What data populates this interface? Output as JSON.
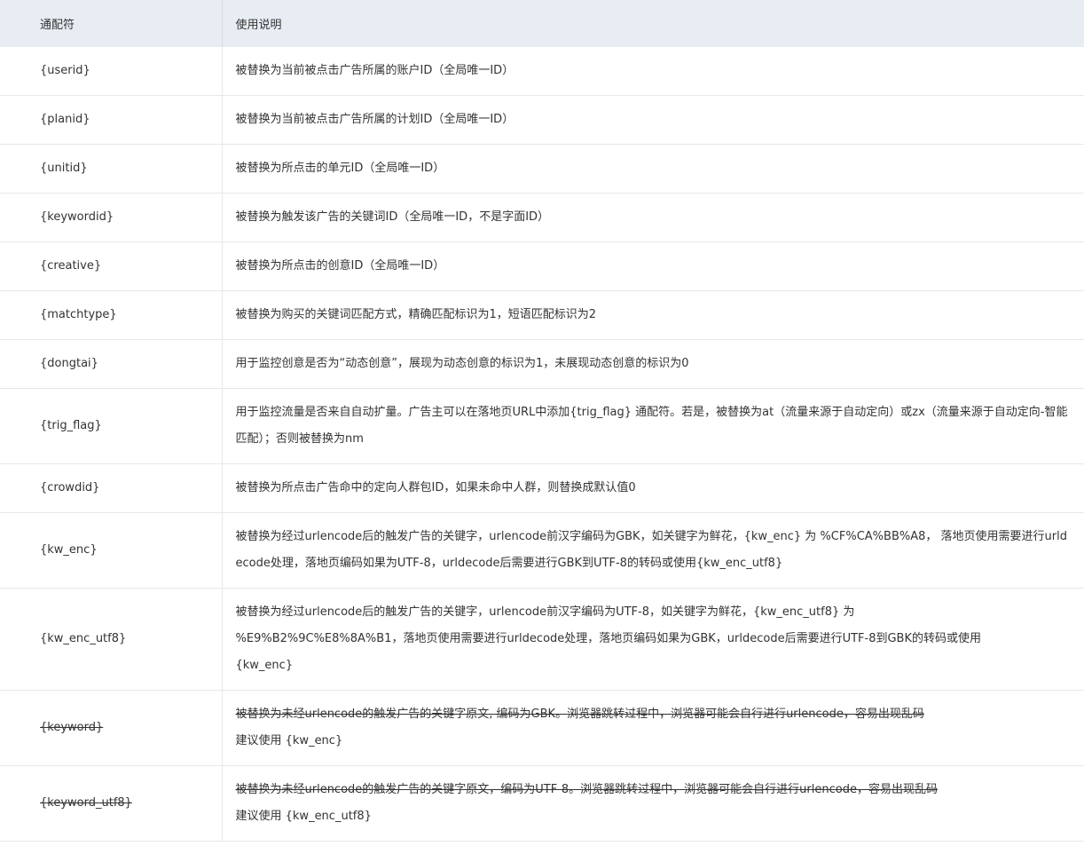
{
  "header": {
    "col_placeholder": "通配符",
    "col_description": "使用说明"
  },
  "rows": [
    {
      "placeholder": "{userid}",
      "description": "被替换为当前被点击广告所属的账户ID（全局唯一ID）"
    },
    {
      "placeholder": "{planid}",
      "description": "被替换为当前被点击广告所属的计划ID（全局唯一ID）"
    },
    {
      "placeholder": "{unitid}",
      "description": "被替换为所点击的单元ID（全局唯一ID）"
    },
    {
      "placeholder": "{keywordid}",
      "description": "被替换为触发该广告的关键词ID（全局唯一ID，不是字面ID）"
    },
    {
      "placeholder": "{creative}",
      "description": "被替换为所点击的创意ID（全局唯一ID）"
    },
    {
      "placeholder": "{matchtype}",
      "description": "被替换为购买的关键词匹配方式，精确匹配标识为1，短语匹配标识为2"
    },
    {
      "placeholder": "{dongtai}",
      "description": "用于监控创意是否为“动态创意”，展现为动态创意的标识为1，未展现动态创意的标识为0"
    },
    {
      "placeholder": "{trig_flag}",
      "description": "用于监控流量是否来自自动扩量。广告主可以在落地页URL中添加{trig_flag} 通配符。若是，被替换为at（流量来源于自动定向）或zx（流量来源于自动定向-智能匹配）；否则被替换为nm"
    },
    {
      "placeholder": "{crowdid}",
      "description": "被替换为所点击广告命中的定向人群包ID，如果未命中人群，则替换成默认值0"
    },
    {
      "placeholder": "{kw_enc}",
      "description": "被替换为经过urlencode后的触发广告的关键字，urlencode前汉字编码为GBK，如关键字为鲜花，{kw_enc} 为 %CF%CA%BB%A8， 落地页使用需要进行urldecode处理，落地页编码如果为UTF-8，urldecode后需要进行GBK到UTF-8的转码或使用{kw_enc_utf8}"
    },
    {
      "placeholder": "{kw_enc_utf8}",
      "description_lines": [
        "被替换为经过urlencode后的触发广告的关键字，urlencode前汉字编码为UTF-8，如关键字为鲜花，{kw_enc_utf8} 为",
        "%E9%B2%9C%E8%8A%B1，落地页使用需要进行urldecode处理，落地页编码如果为GBK，urldecode后需要进行UTF-8到GBK的转码或使用",
        "{kw_enc}"
      ]
    },
    {
      "placeholder": "{keyword}",
      "description_struck": "被替换为未经urlencode的触发广告的关键字原文, 编码为GBK。浏览器跳转过程中，浏览器可能会自行进行urlencode，容易出现乱码",
      "description_note": "建议使用 {kw_enc}"
    },
    {
      "placeholder": "{keyword_utf8}",
      "description_struck": "被替换为未经urlencode的触发广告的关键字原文，编码为UTF-8。浏览器跳转过程中，浏览器可能会自行进行urlencode，容易出现乱码",
      "description_note": "建议使用 {kw_enc_utf8}"
    }
  ]
}
